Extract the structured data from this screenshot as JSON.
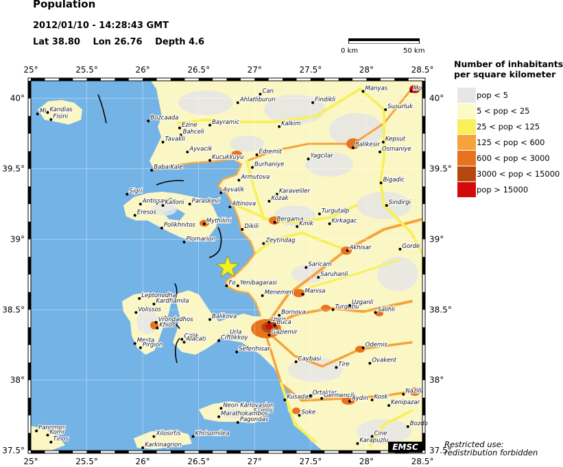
{
  "header": {
    "title": "Population",
    "datetime": "2012/01/10 - 14:28:43 GMT",
    "lat": "Lat 38.80",
    "lon": "Lon 26.76",
    "depth": "Depth  4.6"
  },
  "scale": {
    "start_label": "0 km",
    "end_label": "50 km"
  },
  "axes": {
    "lon_ticks": [
      "25°",
      "25.5°",
      "26°",
      "26.5°",
      "27°",
      "27.5°",
      "28°",
      "28.5°"
    ],
    "lat_ticks_left": [
      "40°",
      "39.5°",
      "39°",
      "38.5°",
      "38°",
      "37.5°"
    ],
    "lat_ticks_right": [
      "40°",
      "39.5°",
      "39°",
      "38.5°",
      "38°",
      "37.5°"
    ]
  },
  "legend": {
    "title_line1": "Number of inhabitants",
    "title_line2": "per square kilometer",
    "items": [
      {
        "label": "pop < 5",
        "color": "#e6e6e6"
      },
      {
        "label": "5 < pop < 25",
        "color": "#fbfbc8"
      },
      {
        "label": "25 < pop < 125",
        "color": "#f7f05a"
      },
      {
        "label": "125 < pop < 600",
        "color": "#f5a33a"
      },
      {
        "label": "600 < pop < 3000",
        "color": "#e8731e"
      },
      {
        "label": "3000 < pop < 15000",
        "color": "#b5480f"
      },
      {
        "label": "pop > 15000",
        "color": "#d40a0a"
      }
    ]
  },
  "colors": {
    "sea": "#74b3e6",
    "epicenter": "#f5f01e"
  },
  "epicenter": {
    "lat": 38.8,
    "lon": 26.76
  },
  "places": [
    {
      "name": "Manyas",
      "lon": 27.97,
      "lat": 40.05
    },
    {
      "name": "Can",
      "lon": 27.05,
      "lat": 40.03
    },
    {
      "name": "Mo",
      "lon": 28.4,
      "lat": 40.05
    },
    {
      "name": "Ahlatliburun",
      "lon": 26.85,
      "lat": 39.97
    },
    {
      "name": "Findikli",
      "lon": 27.52,
      "lat": 39.97
    },
    {
      "name": "Susurluk",
      "lon": 28.17,
      "lat": 39.92
    },
    {
      "name": "Kandias",
      "lon": 25.15,
      "lat": 39.9
    },
    {
      "name": "Mi",
      "lon": 25.06,
      "lat": 39.89
    },
    {
      "name": "Fisini",
      "lon": 25.18,
      "lat": 39.85
    },
    {
      "name": "Bozcaada",
      "lon": 26.05,
      "lat": 39.84
    },
    {
      "name": "Ezine",
      "lon": 26.33,
      "lat": 39.79
    },
    {
      "name": "Bayramic",
      "lon": 26.6,
      "lat": 39.81
    },
    {
      "name": "Kalkim",
      "lon": 27.22,
      "lat": 39.8
    },
    {
      "name": "Bahceli",
      "lon": 26.34,
      "lat": 39.74
    },
    {
      "name": "Tavakli",
      "lon": 26.18,
      "lat": 39.69
    },
    {
      "name": "Kepsut",
      "lon": 28.15,
      "lat": 39.69
    },
    {
      "name": "Ayvacik",
      "lon": 26.4,
      "lat": 39.62
    },
    {
      "name": "Edremit",
      "lon": 27.02,
      "lat": 39.6
    },
    {
      "name": "Balikesir",
      "lon": 27.88,
      "lat": 39.65
    },
    {
      "name": "Osmaniye",
      "lon": 28.12,
      "lat": 39.62
    },
    {
      "name": "Kucukkuyu",
      "lon": 26.6,
      "lat": 39.56
    },
    {
      "name": "Yagcilar",
      "lon": 27.48,
      "lat": 39.57
    },
    {
      "name": "Burhaniye",
      "lon": 26.98,
      "lat": 39.51
    },
    {
      "name": "Baba Kale",
      "lon": 26.08,
      "lat": 39.49
    },
    {
      "name": "Bigadic",
      "lon": 28.13,
      "lat": 39.4
    },
    {
      "name": "Armutova",
      "lon": 26.86,
      "lat": 39.42
    },
    {
      "name": "Ayvalik",
      "lon": 26.7,
      "lat": 39.33
    },
    {
      "name": "Sigri",
      "lon": 25.86,
      "lat": 39.32
    },
    {
      "name": "Karaveliler",
      "lon": 27.2,
      "lat": 39.32
    },
    {
      "name": "Kozak",
      "lon": 27.13,
      "lat": 39.27
    },
    {
      "name": "Antissa",
      "lon": 25.98,
      "lat": 39.25
    },
    {
      "name": "Kalloni",
      "lon": 26.18,
      "lat": 39.24
    },
    {
      "name": "Paraskevi",
      "lon": 26.42,
      "lat": 39.25
    },
    {
      "name": "Altinova",
      "lon": 26.78,
      "lat": 39.23
    },
    {
      "name": "Sindirgi",
      "lon": 28.18,
      "lat": 39.24
    },
    {
      "name": "Eresos",
      "lon": 25.93,
      "lat": 39.17
    },
    {
      "name": "Turgutalp",
      "lon": 27.58,
      "lat": 39.18
    },
    {
      "name": "Bergama",
      "lon": 27.18,
      "lat": 39.12
    },
    {
      "name": "Dikili",
      "lon": 26.89,
      "lat": 39.07
    },
    {
      "name": "Kinik",
      "lon": 27.38,
      "lat": 39.09
    },
    {
      "name": "Kirkagac",
      "lon": 27.67,
      "lat": 39.11
    },
    {
      "name": "Mythilini",
      "lon": 26.55,
      "lat": 39.11
    },
    {
      "name": "Polikhnitos",
      "lon": 26.17,
      "lat": 39.08
    },
    {
      "name": "Plomarion",
      "lon": 26.37,
      "lat": 38.98
    },
    {
      "name": "Zeytindag",
      "lon": 27.08,
      "lat": 38.97
    },
    {
      "name": "Akhisar",
      "lon": 27.83,
      "lat": 38.92
    },
    {
      "name": "Gorde",
      "lon": 28.3,
      "lat": 38.93
    },
    {
      "name": "Saricam",
      "lon": 27.46,
      "lat": 38.8
    },
    {
      "name": "Saruhanli",
      "lon": 27.57,
      "lat": 38.73
    },
    {
      "name": "Fo",
      "lon": 26.75,
      "lat": 38.67
    },
    {
      "name": "Yenibagarasi",
      "lon": 26.85,
      "lat": 38.67
    },
    {
      "name": "Menemen",
      "lon": 27.07,
      "lat": 38.6
    },
    {
      "name": "Manisa",
      "lon": 27.43,
      "lat": 38.61
    },
    {
      "name": "Leptonodha",
      "lon": 25.97,
      "lat": 38.58
    },
    {
      "name": "Kardhamila",
      "lon": 26.1,
      "lat": 38.54
    },
    {
      "name": "Volissos",
      "lon": 25.94,
      "lat": 38.48
    },
    {
      "name": "Turgutlu",
      "lon": 27.7,
      "lat": 38.5
    },
    {
      "name": "Uzganli",
      "lon": 27.85,
      "lat": 38.53
    },
    {
      "name": "Salihli",
      "lon": 28.08,
      "lat": 38.48
    },
    {
      "name": "Vrondadhos",
      "lon": 26.12,
      "lat": 38.41
    },
    {
      "name": "Khios",
      "lon": 26.13,
      "lat": 38.37
    },
    {
      "name": "Balikova",
      "lon": 26.6,
      "lat": 38.43
    },
    {
      "name": "Bornova",
      "lon": 27.22,
      "lat": 38.46
    },
    {
      "name": "Izmir",
      "lon": 27.13,
      "lat": 38.41
    },
    {
      "name": "Buca",
      "lon": 27.18,
      "lat": 38.39
    },
    {
      "name": "Gaziemir",
      "lon": 27.13,
      "lat": 38.32
    },
    {
      "name": "Urla",
      "lon": 26.76,
      "lat": 38.32
    },
    {
      "name": "Citlik",
      "lon": 26.35,
      "lat": 38.29
    },
    {
      "name": "Alacati",
      "lon": 26.37,
      "lat": 38.27
    },
    {
      "name": "Ciftlikkoy",
      "lon": 26.68,
      "lat": 38.28
    },
    {
      "name": "Mesta",
      "lon": 25.93,
      "lat": 38.26
    },
    {
      "name": "Pirgion",
      "lon": 25.98,
      "lat": 38.23
    },
    {
      "name": "Odemis",
      "lon": 27.97,
      "lat": 38.23
    },
    {
      "name": "Seferihisar",
      "lon": 26.84,
      "lat": 38.2
    },
    {
      "name": "Caybasi",
      "lon": 27.37,
      "lat": 38.13
    },
    {
      "name": "Tire",
      "lon": 27.73,
      "lat": 38.09
    },
    {
      "name": "Ovakent",
      "lon": 28.03,
      "lat": 38.12
    },
    {
      "name": "Nazilli",
      "lon": 28.33,
      "lat": 37.9
    },
    {
      "name": "Kusadasi",
      "lon": 27.27,
      "lat": 37.86
    },
    {
      "name": "Ortaklar",
      "lon": 27.5,
      "lat": 37.89
    },
    {
      "name": "Germencik",
      "lon": 27.6,
      "lat": 37.87
    },
    {
      "name": "Aydin",
      "lon": 27.85,
      "lat": 37.85
    },
    {
      "name": "Kosk",
      "lon": 28.05,
      "lat": 37.86
    },
    {
      "name": "Kenipazar",
      "lon": 28.2,
      "lat": 37.82
    },
    {
      "name": "Neon Karlovasion",
      "lon": 26.7,
      "lat": 37.8
    },
    {
      "name": "Samos",
      "lon": 26.97,
      "lat": 37.76
    },
    {
      "name": "Marathokambos",
      "lon": 26.68,
      "lat": 37.74
    },
    {
      "name": "Pagondas",
      "lon": 26.85,
      "lat": 37.7
    },
    {
      "name": "Soke",
      "lon": 27.4,
      "lat": 37.75
    },
    {
      "name": "Bozdo",
      "lon": 28.37,
      "lat": 37.67
    },
    {
      "name": "Pannmos",
      "lon": 25.05,
      "lat": 37.64
    },
    {
      "name": "Komi",
      "lon": 25.15,
      "lat": 37.61
    },
    {
      "name": "Tinos",
      "lon": 25.18,
      "lat": 37.56
    },
    {
      "name": "Xilosirtis",
      "lon": 26.1,
      "lat": 37.6
    },
    {
      "name": "Khrisomilea",
      "lon": 26.45,
      "lat": 37.6
    },
    {
      "name": "Cine",
      "lon": 28.05,
      "lat": 37.6
    },
    {
      "name": "Karapuzlu",
      "lon": 27.92,
      "lat": 37.55
    },
    {
      "name": "Karkinagrion",
      "lon": 26.0,
      "lat": 37.52
    }
  ],
  "footer": {
    "restricted_line1": "Restricted use:",
    "restricted_line2": "redistribution forbidden",
    "logo": "EMSC"
  }
}
